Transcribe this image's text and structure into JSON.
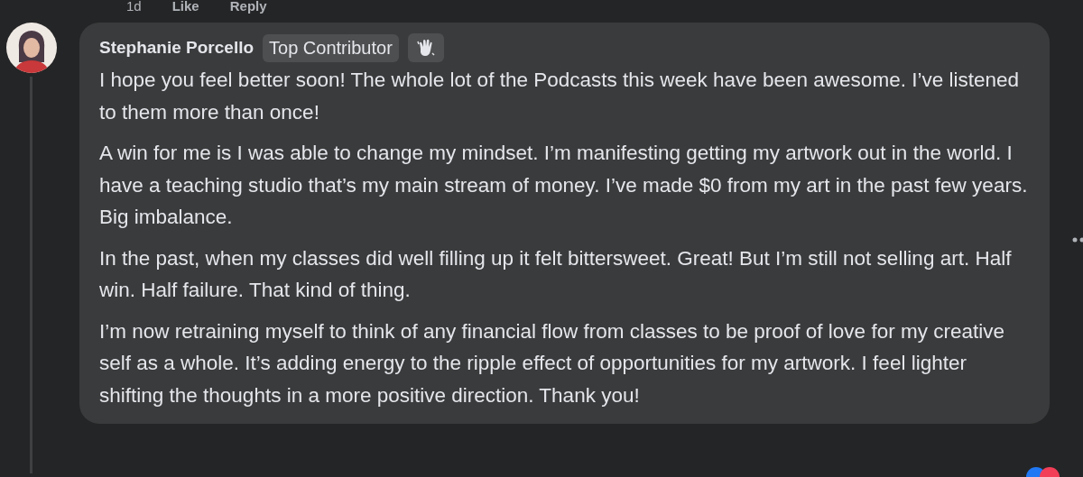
{
  "previous_actions": [
    {
      "label": "1d"
    },
    {
      "label": "Like"
    },
    {
      "label": "Reply"
    }
  ],
  "comment": {
    "author": "Stephanie Porcello",
    "badge": "Top Contributor",
    "paragraphs": [
      "I hope you feel better soon! The whole lot of the Podcasts this week have been awesome. I’ve listened to them more than once!",
      "A win for me is I was able to change my mindset. I’m manifesting getting my artwork out in the world. I have a teaching studio that’s my main stream of money. I’ve made $0 from my art in the past few years. Big imbalance.",
      "In the past, when my classes did well filling up it felt bittersweet. Great! But I’m still not selling art. Half win. Half failure. That kind of thing.",
      "I’m now retraining myself to think of any financial flow from classes to be proof of love for my creative self as a whole. It’s adding energy to the ripple effect of opportunities for my artwork. I feel lighter shifting the thoughts in a more positive direction. Thank you!"
    ]
  }
}
